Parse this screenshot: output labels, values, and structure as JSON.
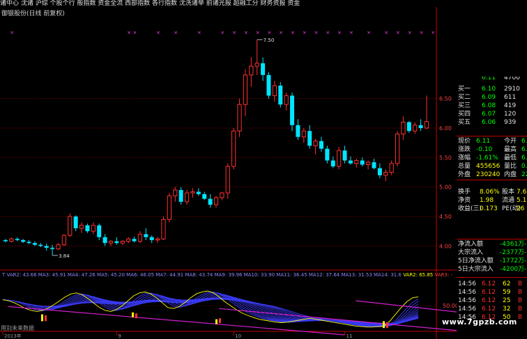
{
  "toolbar": {
    "text": "诸中心 沈诸 沪综 个股个行 般指数 资金全流 西部指数 各行指数 沈洗诸举 前诸光报 超融工分 财务资报 资金相对 龙头股"
  },
  "stock_title": "御银股份(日线 前复权)",
  "colors": {
    "up": "#ff3030",
    "down": "#00e5ff",
    "grid": "#c00000",
    "ma_fan": "#3a3af5",
    "yellow_line": "#ffff00",
    "magenta_line": "#d020d0",
    "panel_green": "#00ff00",
    "axis_text": "#ff4040"
  },
  "chart_data": [
    {
      "type": "candlestick",
      "title": "御银股份(日线 前复权)",
      "y_ticks": [
        4.0,
        4.5,
        5.0,
        5.5,
        6.0,
        6.5
      ],
      "ylim": [
        3.78,
        7.7
      ],
      "grid": true,
      "annotations": [
        {
          "text": "7.50",
          "x": 43,
          "y": 7.5
        },
        {
          "text": "3.84",
          "x": 8,
          "y": 3.84
        }
      ],
      "x_ticks": [
        {
          "label": "2013年",
          "index": 0
        },
        {
          "label": "9",
          "index": 19
        },
        {
          "label": "10",
          "index": 39
        },
        {
          "label": "11",
          "index": 58
        }
      ],
      "candles": [
        [
          4.1,
          4.12,
          4.06,
          4.08
        ],
        [
          4.08,
          4.14,
          4.06,
          4.12
        ],
        [
          4.12,
          4.15,
          4.08,
          4.1
        ],
        [
          4.1,
          4.12,
          4.05,
          4.07
        ],
        [
          4.07,
          4.1,
          4.03,
          4.05
        ],
        [
          4.05,
          4.08,
          4.0,
          4.02
        ],
        [
          4.02,
          4.05,
          3.98,
          4.0
        ],
        [
          4.0,
          4.04,
          3.92,
          3.97
        ],
        [
          3.97,
          4.02,
          3.84,
          3.95
        ],
        [
          3.95,
          4.05,
          3.93,
          4.02
        ],
        [
          4.02,
          4.2,
          4.0,
          4.18
        ],
        [
          4.18,
          4.55,
          4.15,
          4.5
        ],
        [
          4.5,
          4.52,
          4.25,
          4.3
        ],
        [
          4.3,
          4.4,
          4.22,
          4.35
        ],
        [
          4.35,
          4.38,
          4.22,
          4.25
        ],
        [
          4.25,
          4.4,
          4.2,
          4.35
        ],
        [
          4.35,
          4.38,
          4.1,
          4.15
        ],
        [
          4.15,
          4.2,
          4.0,
          4.05
        ],
        [
          4.05,
          4.1,
          4.0,
          4.08
        ],
        [
          4.08,
          4.15,
          4.02,
          4.05
        ],
        [
          4.05,
          4.1,
          4.02,
          4.08
        ],
        [
          4.08,
          4.15,
          4.05,
          4.12
        ],
        [
          4.12,
          4.16,
          4.06,
          4.08
        ],
        [
          4.08,
          4.25,
          4.05,
          4.2
        ],
        [
          4.2,
          4.3,
          4.1,
          4.15
        ],
        [
          4.15,
          4.18,
          4.05,
          4.1
        ],
        [
          4.1,
          4.15,
          4.05,
          4.12
        ],
        [
          4.12,
          4.5,
          4.1,
          4.45
        ],
        [
          4.45,
          4.9,
          4.4,
          4.85
        ],
        [
          4.85,
          5.0,
          4.75,
          4.95
        ],
        [
          4.95,
          5.0,
          4.7,
          4.75
        ],
        [
          4.75,
          4.95,
          4.7,
          4.9
        ],
        [
          4.9,
          4.98,
          4.82,
          4.92
        ],
        [
          4.92,
          4.98,
          4.85,
          4.88
        ],
        [
          4.88,
          4.92,
          4.78,
          4.8
        ],
        [
          4.8,
          4.88,
          4.65,
          4.7
        ],
        [
          4.7,
          4.85,
          4.65,
          4.82
        ],
        [
          4.82,
          4.92,
          4.78,
          4.9
        ],
        [
          4.9,
          5.4,
          4.8,
          5.35
        ],
        [
          5.35,
          6.0,
          5.3,
          5.95
        ],
        [
          5.95,
          6.5,
          5.85,
          6.4
        ],
        [
          6.4,
          7.0,
          6.2,
          6.9
        ],
        [
          6.9,
          7.2,
          6.7,
          7.05
        ],
        [
          7.05,
          7.5,
          6.9,
          7.1
        ],
        [
          7.1,
          7.2,
          6.8,
          6.9
        ],
        [
          6.9,
          6.95,
          6.5,
          6.55
        ],
        [
          6.55,
          6.8,
          6.45,
          6.72
        ],
        [
          6.72,
          6.78,
          6.35,
          6.4
        ],
        [
          6.4,
          6.6,
          6.3,
          6.55
        ],
        [
          6.55,
          6.6,
          5.95,
          6.05
        ],
        [
          6.05,
          6.15,
          5.8,
          5.85
        ],
        [
          5.85,
          6.0,
          5.75,
          5.95
        ],
        [
          5.95,
          6.05,
          5.65,
          5.7
        ],
        [
          5.7,
          5.82,
          5.55,
          5.78
        ],
        [
          5.78,
          5.85,
          5.6,
          5.65
        ],
        [
          5.65,
          5.7,
          5.4,
          5.45
        ],
        [
          5.45,
          5.52,
          5.32,
          5.35
        ],
        [
          5.35,
          5.68,
          5.3,
          5.62
        ],
        [
          5.62,
          5.7,
          5.4,
          5.45
        ],
        [
          5.45,
          5.52,
          5.38,
          5.4
        ],
        [
          5.4,
          5.48,
          5.33,
          5.45
        ],
        [
          5.45,
          5.5,
          5.35,
          5.38
        ],
        [
          5.38,
          5.45,
          5.3,
          5.42
        ],
        [
          5.42,
          5.48,
          5.3,
          5.32
        ],
        [
          5.32,
          5.4,
          5.15,
          5.2
        ],
        [
          5.2,
          5.3,
          5.1,
          5.25
        ],
        [
          5.25,
          5.45,
          5.2,
          5.4
        ],
        [
          5.4,
          5.95,
          5.35,
          5.9
        ],
        [
          5.9,
          6.2,
          5.8,
          6.1
        ],
        [
          6.1,
          6.12,
          5.92,
          5.95
        ],
        [
          5.95,
          6.1,
          5.9,
          6.05
        ],
        [
          6.05,
          6.15,
          5.95,
          6.0
        ],
        [
          6.0,
          6.55,
          5.98,
          6.11
        ]
      ],
      "markers": [
        1,
        21,
        22,
        26,
        29,
        33,
        37,
        39,
        41,
        43,
        45,
        47,
        49,
        51,
        53,
        55,
        57,
        59,
        62,
        65,
        67,
        69,
        71,
        73
      ],
      "marker_color": "#ff40ff"
    },
    {
      "type": "line",
      "title": "",
      "y_ticks": [
        50.0
      ],
      "ylim": [
        0,
        100
      ],
      "legend": [
        {
          "name": "VAR2",
          "value": "65.85"
        },
        {
          "name": "VAR3",
          "value": "-"
        }
      ],
      "yellow_series": [
        62,
        60,
        56,
        50,
        44,
        40,
        38,
        40,
        45,
        52,
        60,
        68,
        74,
        76,
        72,
        64,
        55,
        46,
        40,
        38,
        42,
        50,
        60,
        70,
        76,
        78,
        74,
        66,
        56,
        46,
        44,
        48,
        56,
        66,
        74,
        78,
        80,
        76,
        68,
        58,
        50,
        42,
        35,
        30,
        26,
        22,
        20,
        18,
        16,
        15,
        16,
        18,
        20,
        22,
        24,
        22,
        20,
        18,
        16,
        14,
        12,
        10,
        8,
        7,
        6,
        6,
        7,
        8,
        18,
        32,
        46,
        58,
        66,
        68
      ],
      "ma_series_count": 14,
      "bars": [
        {
          "x": 11,
          "y0": 18,
          "y1": 32,
          "color": "#ffff00"
        },
        {
          "x": 12,
          "y0": 18,
          "y1": 30,
          "color": "#ff3030"
        },
        {
          "x": 37,
          "y0": 26,
          "y1": 36,
          "color": "#ffff00"
        },
        {
          "x": 38,
          "y0": 24,
          "y1": 34,
          "color": "#ff3030"
        },
        {
          "x": 61,
          "y0": 12,
          "y1": 22,
          "color": "#ffff00"
        },
        {
          "x": 62,
          "y0": 14,
          "y1": 24,
          "color": "#ff3030"
        },
        {
          "x": 109,
          "y0": 4,
          "y1": 18,
          "color": "#ffff00"
        },
        {
          "x": 110,
          "y0": 4,
          "y1": 16,
          "color": "#ff3030"
        }
      ],
      "diagonals": [
        {
          "from": [
            1,
            48
          ],
          "to": [
            60,
            -10
          ]
        },
        {
          "from": [
            38,
            44
          ],
          "to": [
            88,
            -10
          ]
        },
        {
          "from": [
            62,
            60
          ],
          "to": [
            116,
            -10
          ]
        },
        {
          "from": [
            80,
            72
          ],
          "to": [
            146,
            -10
          ]
        }
      ]
    }
  ],
  "indicator_line": {
    "ma_text": "T VAR2: 43.66 MA3: 45.91 MA4: 47.26 MA5: 45.20 MA6: 46.05 MA7: 44.91 MA8: 43.74 MA9: 39.96 MA10: 33.90 MA11: 36.45 MA12: 37.64 MA13: 31.53 MA14: 31.6",
    "var2_text": "VAR2: 65.85",
    "var3_text": "VAR3: -"
  },
  "bottom_note": "用别未来数据",
  "watermark": "www.7gpzb.com",
  "quote_panel": {
    "order_book": [
      {
        "label": "买一",
        "price": "6.10",
        "vol": "2910"
      },
      {
        "label": "买二",
        "price": "6.09",
        "vol": "611"
      },
      {
        "label": "买三",
        "price": "6.08",
        "vol": "419"
      },
      {
        "label": "买四",
        "price": "6.07",
        "vol": "120"
      },
      {
        "label": "买五",
        "price": "6.06",
        "vol": "939"
      }
    ],
    "top_partial": {
      "price": "6.11",
      "vol": "4700"
    },
    "stats": [
      {
        "l1": "现价",
        "v1": "6.11",
        "l2": "今开",
        "v2": "6."
      },
      {
        "l1": "涨跌",
        "v1": "-0.10",
        "l2": "最高",
        "v2": "6."
      },
      {
        "l1": "涨幅",
        "v1": "-1.61%",
        "l2": "最低",
        "v2": "6."
      },
      {
        "l1": "总量",
        "v1": "455656",
        "l2": "量比",
        "v2": "0."
      },
      {
        "l1": "外盘",
        "v1": "230240",
        "l2": "内盘",
        "v2": "2254"
      }
    ],
    "fundamentals": [
      {
        "l1": "换手",
        "v1": "8.06%",
        "l2": "股本",
        "v2": "7.61"
      },
      {
        "l1": "净资",
        "v1": "1.98",
        "l2": "流通",
        "v2": "5.15"
      },
      {
        "l1": "收益(三)",
        "v1": "0.173",
        "l2": "PE(动)",
        "v2": "26"
      }
    ],
    "flows": [
      {
        "label": "净流入额",
        "value": "-4361万",
        "extra": "-1"
      },
      {
        "label": "大宗流入",
        "value": "-2377万",
        "extra": "-1"
      },
      {
        "label": "5日净流入额",
        "value": "-1772万",
        "extra": "-"
      },
      {
        "label": "5日大宗流入",
        "value": "-4200万",
        "extra": "-"
      }
    ],
    "ticks": [
      {
        "time": "14:56",
        "price": "6.12",
        "vol": "62",
        "side": "B"
      },
      {
        "time": "14:56",
        "price": "6.12",
        "vol": "59",
        "side": "B"
      },
      {
        "time": "14:56",
        "price": "6.12",
        "vol": "25",
        "side": "B"
      },
      {
        "time": "14:56",
        "price": "6.12",
        "vol": "32",
        "side": "B"
      },
      {
        "time": "14:56",
        "price": "6.12",
        "vol": "50",
        "side": "B"
      }
    ]
  }
}
